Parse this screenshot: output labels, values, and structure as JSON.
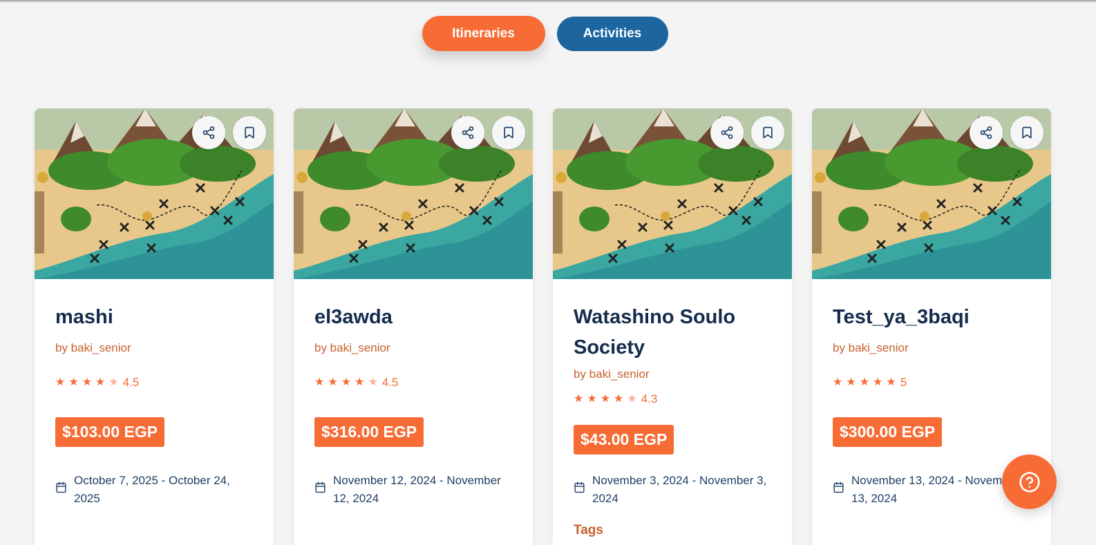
{
  "tabs": {
    "itineraries_label": "Itineraries",
    "activities_label": "Activities"
  },
  "cards": [
    {
      "title": "mashi",
      "author": "by baki_senior",
      "rating_text": "4.5",
      "rating": 4.5,
      "price": "$103.00 EGP",
      "dates": "October 7, 2025 - October 24, 2025"
    },
    {
      "title": "el3awda",
      "author": "by baki_senior",
      "rating_text": "4.5",
      "rating": 4.5,
      "price": "$316.00 EGP",
      "dates": "November 12, 2024 - November 12, 2024"
    },
    {
      "title": "Watashino Soulo Society",
      "author": "by baki_senior",
      "rating_text": "4.3",
      "rating": 4.3,
      "price": "$43.00 EGP",
      "dates": "November 3, 2024 - November 3, 2024",
      "tags_label": "Tags"
    },
    {
      "title": "Test_ya_3baqi",
      "author": "by baki_senior",
      "rating_text": "5",
      "rating": 5,
      "price": "$300.00 EGP",
      "dates": "November 13, 2024 - November 13, 2024"
    }
  ],
  "icons": {
    "share": "share-icon",
    "bookmark": "bookmark-icon",
    "calendar": "calendar-icon",
    "help": "help-icon"
  },
  "colors": {
    "accent_orange": "#f76b35",
    "accent_blue": "#1c659f",
    "title_navy": "#132c4b",
    "author_orange": "#c8602b"
  }
}
